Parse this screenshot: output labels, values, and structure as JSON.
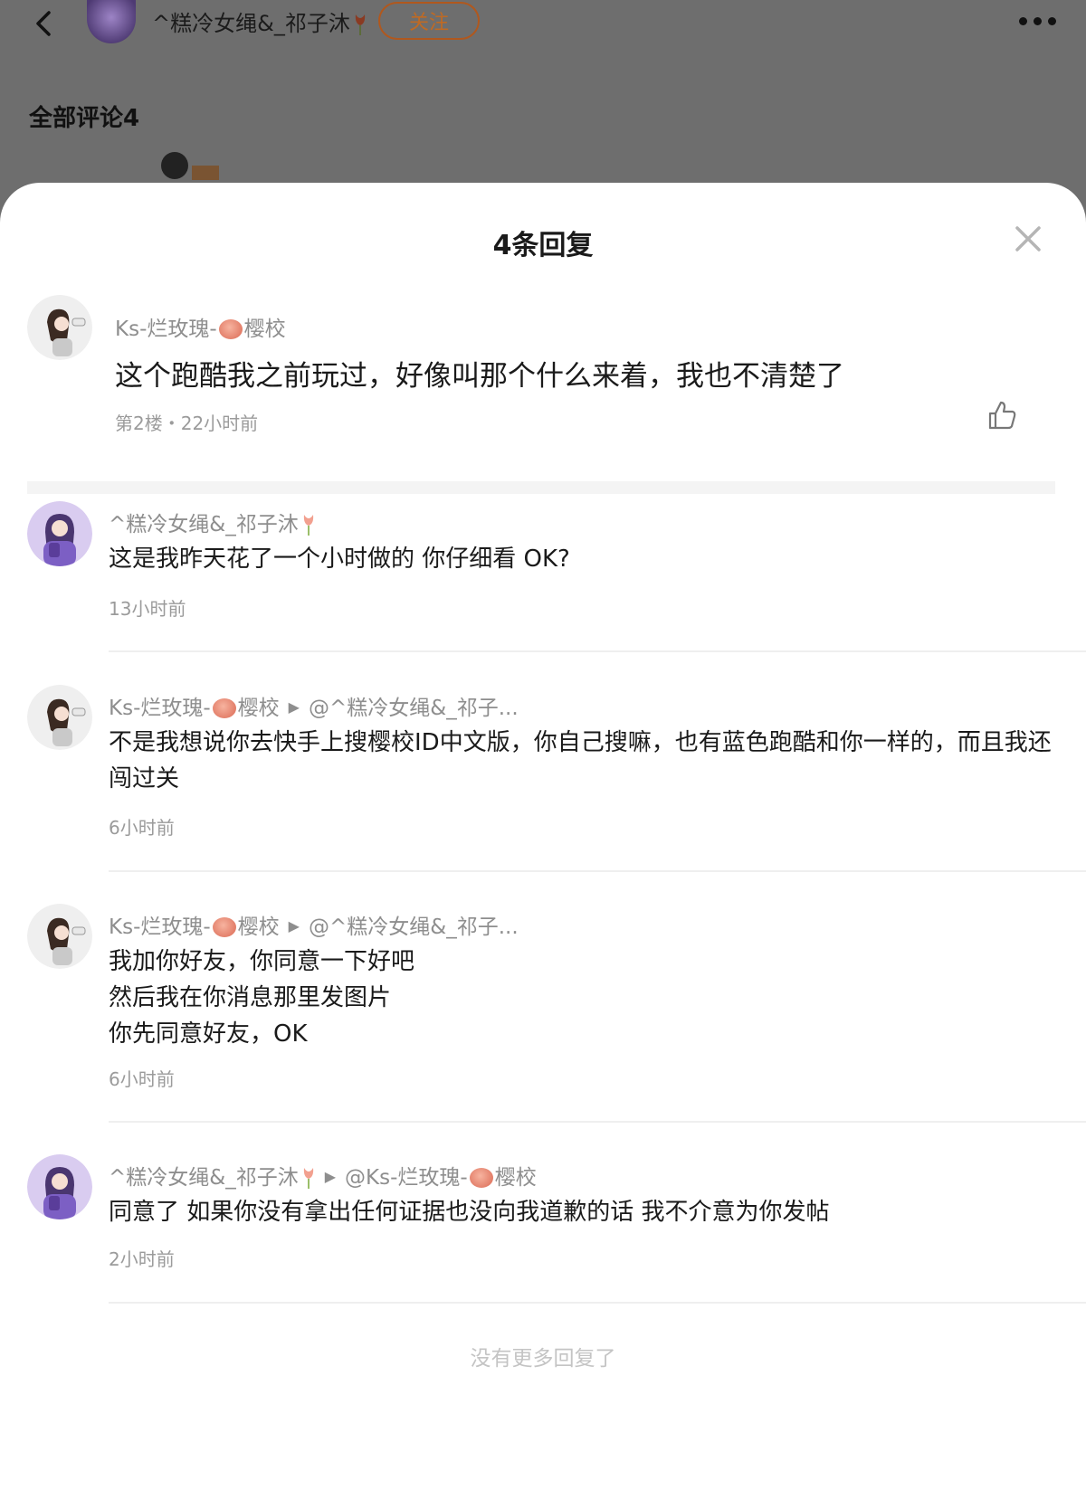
{
  "header": {
    "username": "^糕冷女绳&_祁子沐",
    "follow_label": "关注",
    "all_comments_label": "全部评论4"
  },
  "sheet": {
    "title": "4条回复",
    "parent": {
      "username": "Ks-烂玫瑰-",
      "username_suffix": "樱校",
      "text": "这个跑酷我之前玩过，好像叫那个什么来着，我也不清楚了",
      "floor": "第2楼",
      "dot": "・",
      "time": "22小时前"
    },
    "replies": [
      {
        "username": "^糕冷女绳&_祁子沐",
        "text": "这是我昨天花了一个小时做的 你仔细看 OK?",
        "time": "13小时前"
      },
      {
        "username": "Ks-烂玫瑰-",
        "username_suffix": "樱校",
        "reply_to": "@^糕冷女绳&_祁子...",
        "text": "不是我想说你去快手上搜樱校ID中文版，你自己搜嘛，也有蓝色跑酷和你一样的，而且我还闯过关",
        "time": "6小时前"
      },
      {
        "username": "Ks-烂玫瑰-",
        "username_suffix": "樱校",
        "reply_to": "@^糕冷女绳&_祁子...",
        "text_lines": [
          "我加你好友，你同意一下好吧",
          "然后我在你消息那里发图片",
          "你先同意好友，OK"
        ],
        "time": "6小时前"
      },
      {
        "username": "^糕冷女绳&_祁子沐",
        "reply_to_prefix": "@Ks-烂玫瑰-",
        "reply_to_suffix": "樱校",
        "text": "同意了 如果你没有拿出任何证据也没向我道歉的话 我不介意为你发帖",
        "time": "2小时前"
      }
    ],
    "no_more": "没有更多回复了"
  },
  "colors": {
    "follow_accent": "#bf6a24",
    "muted_text": "#8e8e8e",
    "backdrop": "#6e6e6e"
  },
  "icons": {
    "back": "chevron-left-icon",
    "more": "more-dots-icon",
    "close": "close-icon",
    "like": "thumbs-up-icon"
  }
}
